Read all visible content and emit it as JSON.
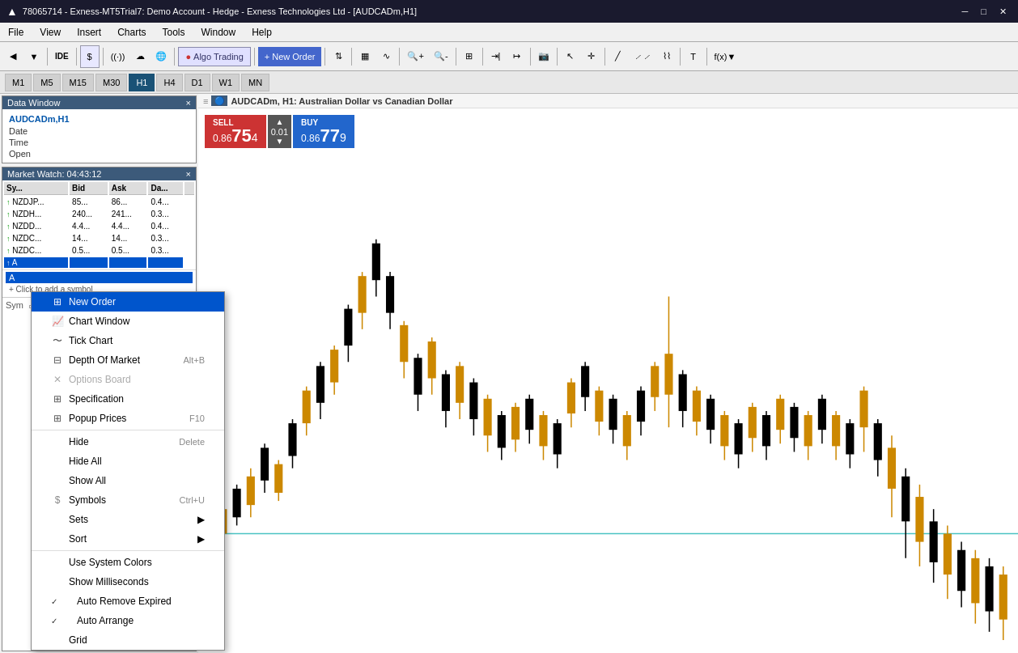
{
  "titleBar": {
    "text": "78065714 - Exness-MT5Trial7: Demo Account - Hedge - Exness Technologies Ltd - [AUDCADm,H1]",
    "icon": "▲"
  },
  "menuBar": {
    "items": [
      "File",
      "View",
      "Insert",
      "Charts",
      "Tools",
      "Window",
      "Help"
    ]
  },
  "toolbar": {
    "algoTrading": "Algo Trading",
    "newOrder": "New Order"
  },
  "timeframes": {
    "items": [
      "M1",
      "M5",
      "M15",
      "M30",
      "H1",
      "H4",
      "D1",
      "W1",
      "MN"
    ],
    "active": "H1"
  },
  "dataWindow": {
    "title": "Data Window",
    "symbol": "AUDCADm,H1",
    "fields": [
      {
        "label": "Date",
        "value": ""
      },
      {
        "label": "Time",
        "value": ""
      },
      {
        "label": "Open",
        "value": ""
      }
    ],
    "closeBtn": "×"
  },
  "marketWatch": {
    "title": "Market Watch: 04:43:12",
    "closeBtn": "×",
    "columns": [
      "Sy...",
      "Bid",
      "Ask",
      "Da..."
    ],
    "rows": [
      {
        "symbol": "NZDJP...",
        "arrow": "↑",
        "bid": "85...",
        "ask": "86...",
        "daily": "0.4...",
        "selected": false
      },
      {
        "symbol": "NZDH...",
        "arrow": "↑",
        "bid": "240...",
        "ask": "241...",
        "daily": "0.3...",
        "selected": false
      },
      {
        "symbol": "NZDD...",
        "arrow": "↑",
        "bid": "4.4...",
        "ask": "4.4...",
        "daily": "0.4...",
        "selected": false
      },
      {
        "symbol": "NZDC...",
        "arrow": "↑",
        "bid": "14...",
        "ask": "14...",
        "daily": "0.3...",
        "selected": false
      },
      {
        "symbol": "NZDC...",
        "arrow": "↑",
        "bid": "0.5...",
        "ask": "0.5...",
        "daily": "0.3...",
        "selected": false
      },
      {
        "symbol": "A",
        "arrow": "↑",
        "bid": "",
        "ask": "",
        "daily": "",
        "selected": true
      }
    ]
  },
  "contextMenu": {
    "items": [
      {
        "id": "new-order",
        "label": "New Order",
        "shortcut": "",
        "icon": "order",
        "highlighted": true,
        "disabled": false,
        "separator": false,
        "hasArrow": false,
        "checkmark": false
      },
      {
        "id": "chart-window",
        "label": "Chart Window",
        "shortcut": "",
        "icon": "chart-win",
        "highlighted": false,
        "disabled": false,
        "separator": false,
        "hasArrow": false,
        "checkmark": false
      },
      {
        "id": "tick-chart",
        "label": "Tick Chart",
        "shortcut": "",
        "icon": "tick",
        "highlighted": false,
        "disabled": false,
        "separator": false,
        "hasArrow": false,
        "checkmark": false
      },
      {
        "id": "depth-of-market",
        "label": "Depth Of Market",
        "shortcut": "Alt+B",
        "icon": "dom",
        "highlighted": false,
        "disabled": false,
        "separator": false,
        "hasArrow": false,
        "checkmark": false
      },
      {
        "id": "options-board",
        "label": "Options Board",
        "shortcut": "",
        "icon": "options",
        "highlighted": false,
        "disabled": true,
        "separator": false,
        "hasArrow": false,
        "checkmark": false
      },
      {
        "id": "specification",
        "label": "Specification",
        "shortcut": "",
        "icon": "spec",
        "highlighted": false,
        "disabled": false,
        "separator": false,
        "hasArrow": false,
        "checkmark": false
      },
      {
        "id": "popup-prices",
        "label": "Popup Prices",
        "shortcut": "F10",
        "icon": "popup",
        "highlighted": false,
        "disabled": false,
        "separator": false,
        "hasArrow": false,
        "checkmark": false
      },
      {
        "id": "sep1",
        "label": "",
        "shortcut": "",
        "icon": "",
        "highlighted": false,
        "disabled": false,
        "separator": true,
        "hasArrow": false,
        "checkmark": false
      },
      {
        "id": "hide",
        "label": "Hide",
        "shortcut": "Delete",
        "icon": "",
        "highlighted": false,
        "disabled": false,
        "separator": false,
        "hasArrow": false,
        "checkmark": false
      },
      {
        "id": "hide-all",
        "label": "Hide All",
        "shortcut": "",
        "icon": "",
        "highlighted": false,
        "disabled": false,
        "separator": false,
        "hasArrow": false,
        "checkmark": false
      },
      {
        "id": "show-all",
        "label": "Show All",
        "shortcut": "",
        "icon": "",
        "highlighted": false,
        "disabled": false,
        "separator": false,
        "hasArrow": false,
        "checkmark": false
      },
      {
        "id": "symbols",
        "label": "Symbols",
        "shortcut": "Ctrl+U",
        "icon": "symbols",
        "highlighted": false,
        "disabled": false,
        "separator": false,
        "hasArrow": false,
        "checkmark": false
      },
      {
        "id": "sets",
        "label": "Sets",
        "shortcut": "",
        "icon": "",
        "highlighted": false,
        "disabled": false,
        "separator": false,
        "hasArrow": true,
        "checkmark": false
      },
      {
        "id": "sort",
        "label": "Sort",
        "shortcut": "",
        "icon": "",
        "highlighted": false,
        "disabled": false,
        "separator": false,
        "hasArrow": true,
        "checkmark": false
      },
      {
        "id": "sep2",
        "label": "",
        "shortcut": "",
        "icon": "",
        "highlighted": false,
        "disabled": false,
        "separator": true,
        "hasArrow": false,
        "checkmark": false
      },
      {
        "id": "use-system-colors",
        "label": "Use System Colors",
        "shortcut": "",
        "icon": "",
        "highlighted": false,
        "disabled": false,
        "separator": false,
        "hasArrow": false,
        "checkmark": false
      },
      {
        "id": "show-milliseconds",
        "label": "Show Milliseconds",
        "shortcut": "",
        "icon": "",
        "highlighted": false,
        "disabled": false,
        "separator": false,
        "hasArrow": false,
        "checkmark": false
      },
      {
        "id": "auto-remove-expired",
        "label": "Auto Remove Expired",
        "shortcut": "",
        "icon": "",
        "highlighted": false,
        "disabled": false,
        "separator": false,
        "hasArrow": false,
        "checkmark": true
      },
      {
        "id": "auto-arrange",
        "label": "Auto Arrange",
        "shortcut": "",
        "icon": "",
        "highlighted": false,
        "disabled": false,
        "separator": false,
        "hasArrow": false,
        "checkmark": true
      },
      {
        "id": "grid",
        "label": "Grid",
        "shortcut": "",
        "icon": "",
        "highlighted": false,
        "disabled": false,
        "separator": false,
        "hasArrow": false,
        "checkmark": false
      }
    ]
  },
  "chart": {
    "header": "AUDCADm, H1:  Australian Dollar vs Canadian Dollar",
    "headerIcon": "≡",
    "sell": {
      "label": "SELL",
      "price": "75",
      "decimal": "4",
      "prefix": "0.86"
    },
    "buy": {
      "label": "BUY",
      "price": "77",
      "decimal": "9",
      "prefix": "0.86"
    },
    "qty": "0.01"
  },
  "colors": {
    "sellBg": "#cc3333",
    "buyBg": "#2255bb",
    "bullCandle": "#000000",
    "bearCandle": "#cc8800",
    "headerBg": "#3c5a7a",
    "highlight": "#0055cc"
  }
}
